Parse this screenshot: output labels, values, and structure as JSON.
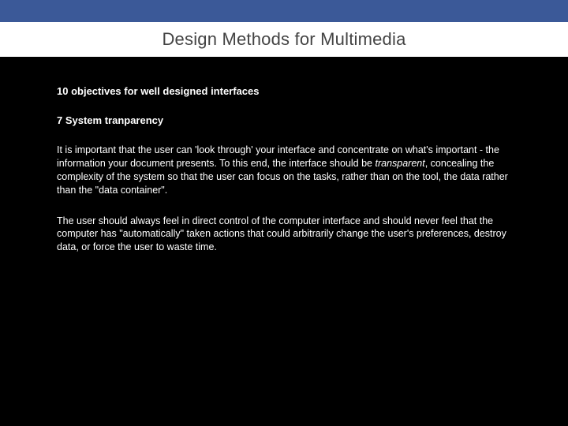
{
  "header": {
    "title": "Design Methods for Multimedia"
  },
  "content": {
    "subtitle": "10 objectives for well designed interfaces",
    "section_heading": "7 System tranparency",
    "para1_pre": "It is important that the user can 'look through' your interface and concentrate on what's important - the information your document presents. To this end, the interface should be ",
    "para1_em": "transparent",
    "para1_post": ", concealing the complexity of the system so that the user can focus on the tasks, rather than on the tool, the data rather than the \"data container\".",
    "para2": "The user should always feel in direct control of the computer interface and should never feel that the computer has \"automatically\" taken actions that could arbitrarily change the user's preferences, destroy data, or force the user to waste time."
  }
}
